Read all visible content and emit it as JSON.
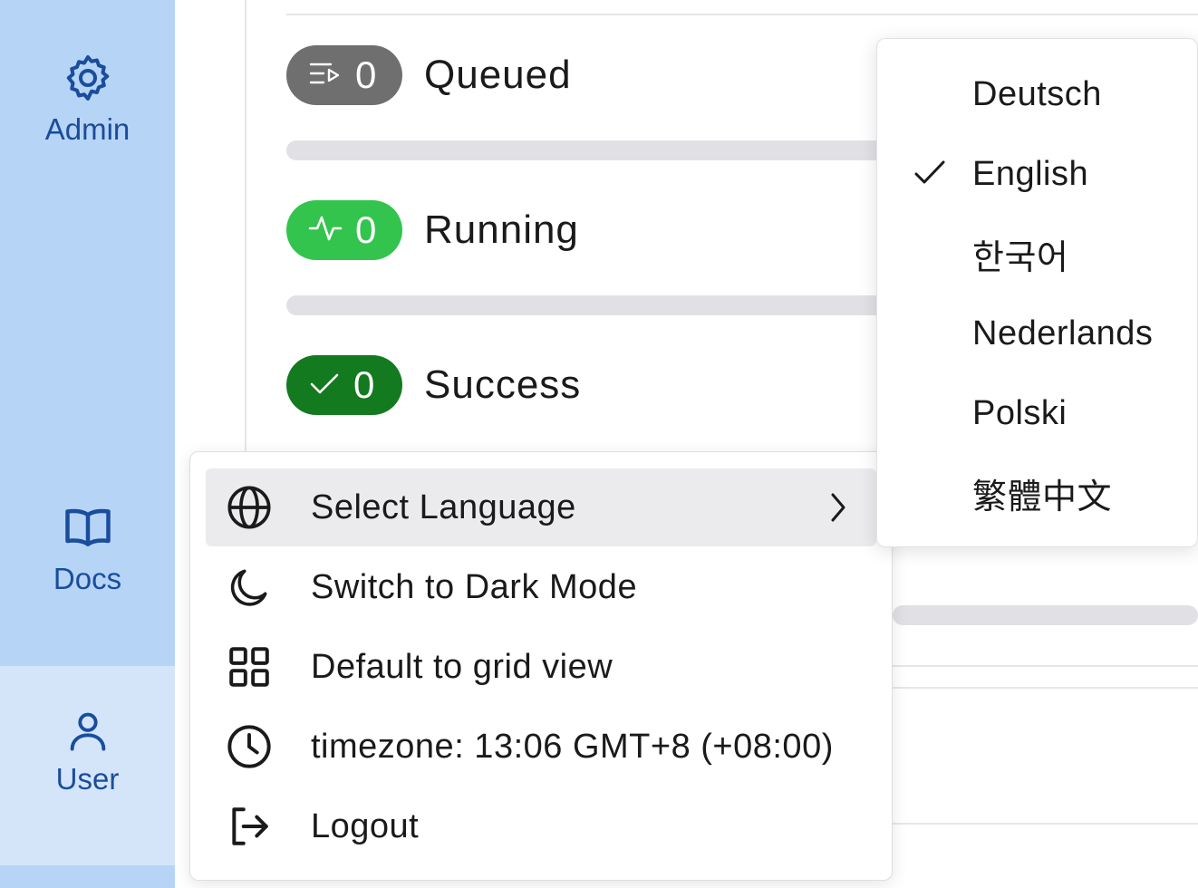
{
  "sidebar": {
    "admin_label": "Admin",
    "docs_label": "Docs",
    "user_label": "User"
  },
  "statuses": [
    {
      "icon": "queue-icon",
      "count": "0",
      "label": "Queued",
      "color": "#6f6f6f"
    },
    {
      "icon": "activity-icon",
      "count": "0",
      "label": "Running",
      "color": "#33c44d"
    },
    {
      "icon": "check-icon",
      "count": "0",
      "label": "Success",
      "color": "#137a1f"
    }
  ],
  "user_menu": {
    "items": [
      {
        "icon": "globe-icon",
        "label": "Select Language",
        "has_submenu": true
      },
      {
        "icon": "moon-icon",
        "label": "Switch to Dark Mode"
      },
      {
        "icon": "grid-icon",
        "label": "Default to grid view"
      },
      {
        "icon": "clock-icon",
        "label": "timezone: 13:06 GMT+8 (+08:00)"
      },
      {
        "icon": "logout-icon",
        "label": "Logout"
      }
    ]
  },
  "language_menu": {
    "selected": "English",
    "items": [
      {
        "label": "Deutsch"
      },
      {
        "label": "English"
      },
      {
        "label": "한국어"
      },
      {
        "label": "Nederlands"
      },
      {
        "label": "Polski"
      },
      {
        "label": "繁體中文"
      }
    ]
  },
  "colors": {
    "sidebar_bg": "#b6d4f6",
    "sidebar_active_bg": "#d4e5fa",
    "sidebar_text": "#1a4d9c"
  }
}
